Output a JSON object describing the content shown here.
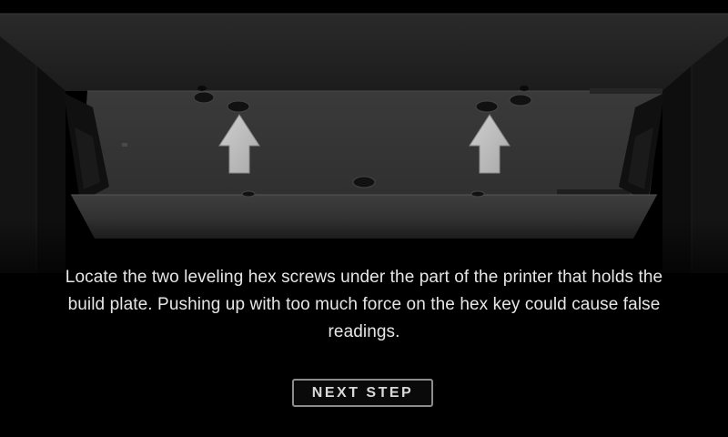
{
  "instruction": {
    "text": "Locate the two leveling hex screws under the part of the printer that holds the build plate. Pushing up with too much force on the hex key could cause false readings."
  },
  "buttons": {
    "next_label": "NEXT STEP"
  },
  "illustration": {
    "subject": "printer-build-plate-underside",
    "indicators": [
      "up-arrow-icon",
      "up-arrow-icon"
    ]
  },
  "colors": {
    "background": "#000000",
    "text": "#e6e6e6",
    "button_border": "#8c8c8c",
    "arrow": "#bfbfbf"
  }
}
